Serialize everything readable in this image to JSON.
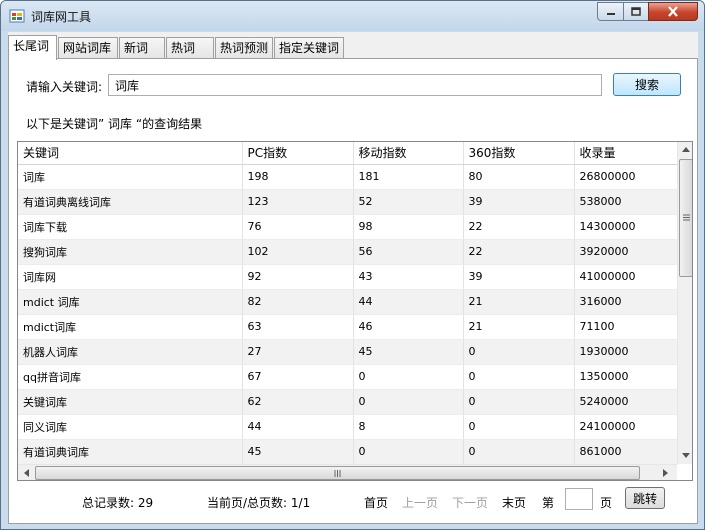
{
  "window": {
    "title": "词库网工具"
  },
  "tabs": [
    "长尾词",
    "网站词库",
    "新词",
    "热词",
    "热词预测",
    "指定关键词"
  ],
  "search": {
    "label": "请输入关键词:",
    "value": "词库",
    "button": "搜索"
  },
  "result_caption": "以下是关键词” 词库 “的查询结果",
  "table": {
    "columns": [
      "关键词",
      "PC指数",
      "移动指数",
      "360指数",
      "收录量"
    ],
    "rows": [
      [
        "词库",
        "198",
        "181",
        "80",
        "26800000"
      ],
      [
        "有道词典离线词库",
        "123",
        "52",
        "39",
        "538000"
      ],
      [
        "词库下载",
        "76",
        "98",
        "22",
        "14300000"
      ],
      [
        "搜狗词库",
        "102",
        "56",
        "22",
        "3920000"
      ],
      [
        "词库网",
        "92",
        "43",
        "39",
        "41000000"
      ],
      [
        "mdict 词库",
        "82",
        "44",
        "21",
        "316000"
      ],
      [
        "mdict词库",
        "63",
        "46",
        "21",
        "71100"
      ],
      [
        "机器人词库",
        "27",
        "45",
        "0",
        "1930000"
      ],
      [
        "qq拼音词库",
        "67",
        "0",
        "0",
        "1350000"
      ],
      [
        "关键词库",
        "62",
        "0",
        "0",
        "5240000"
      ],
      [
        "同义词库",
        "44",
        "8",
        "0",
        "24100000"
      ],
      [
        "有道词典词库",
        "45",
        "0",
        "0",
        "861000"
      ]
    ]
  },
  "pager": {
    "total_label": "总记录数: 29",
    "page_label": "当前页/总页数: 1/1",
    "first": "首页",
    "prev": "上一页",
    "next": "下一页",
    "last": "末页",
    "page_prefix": "第",
    "page_suffix": "页",
    "jump": "跳转",
    "page_value": ""
  }
}
